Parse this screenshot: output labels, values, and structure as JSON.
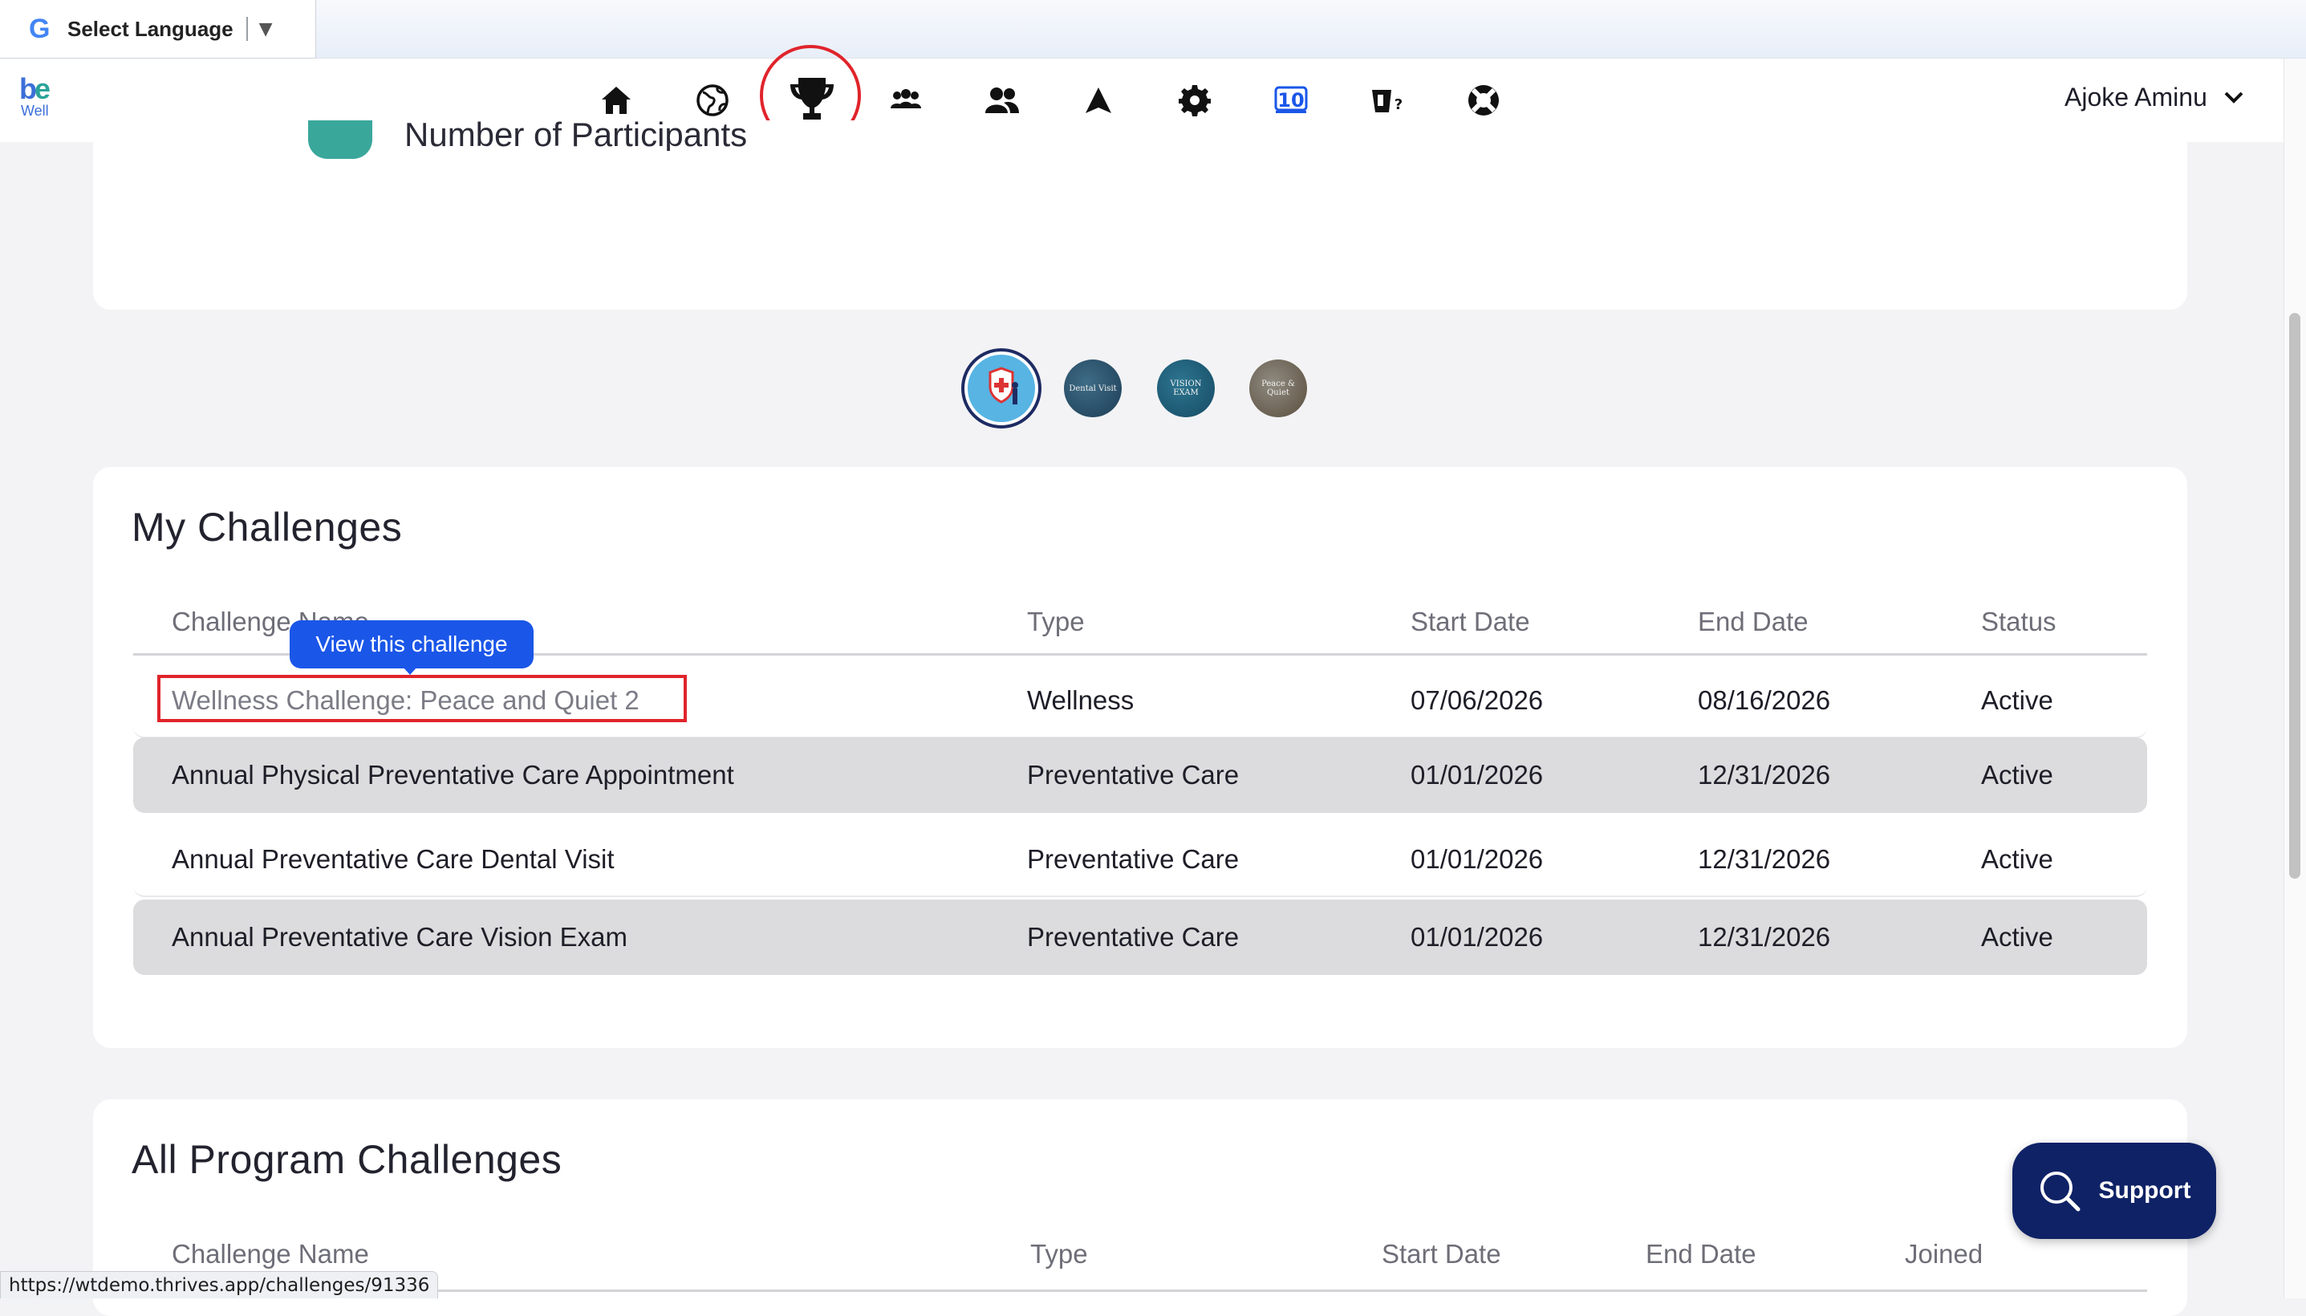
{
  "translate": {
    "label": "Select Language",
    "arrow": "▼"
  },
  "logo": {
    "be_b": "b",
    "be_e": "e",
    "well": "Well"
  },
  "nav": {
    "items": [
      {
        "name": "home-icon"
      },
      {
        "name": "globe-icon"
      },
      {
        "name": "trophy-icon"
      },
      {
        "name": "groups-icon"
      },
      {
        "name": "people-icon"
      },
      {
        "name": "navigation-arrow-icon"
      },
      {
        "name": "gear-icon"
      },
      {
        "name": "counter-10-icon"
      },
      {
        "name": "cup-question-icon"
      },
      {
        "name": "lifebuoy-icon"
      }
    ],
    "counter_value": "10",
    "user_name": "Ajoke Aminu"
  },
  "summary": {
    "participants_label": "Number of Participants"
  },
  "badges": [
    {
      "label": ""
    },
    {
      "label": "Dental Visit"
    },
    {
      "label": "VISION EXAM"
    },
    {
      "label": "Peace & Quiet"
    }
  ],
  "my_challenges": {
    "title": "My Challenges",
    "columns": [
      "Challenge Name",
      "Type",
      "Start Date",
      "End Date",
      "Status"
    ],
    "tooltip": "View this challenge",
    "rows": [
      [
        "Wellness Challenge: Peace and Quiet 2",
        "Wellness",
        "07/06/2026",
        "08/16/2026",
        "Active"
      ],
      [
        "Annual Physical Preventative Care Appointment",
        "Preventative Care",
        "01/01/2026",
        "12/31/2026",
        "Active"
      ],
      [
        "Annual Preventative Care Dental Visit",
        "Preventative Care",
        "01/01/2026",
        "12/31/2026",
        "Active"
      ],
      [
        "Annual Preventative Care Vision Exam",
        "Preventative Care",
        "01/01/2026",
        "12/31/2026",
        "Active"
      ]
    ]
  },
  "all_challenges": {
    "title": "All Program Challenges",
    "columns": [
      "Challenge Name",
      "Type",
      "Start Date",
      "End Date",
      "Joined"
    ]
  },
  "support": {
    "label": "Support"
  },
  "status_url": "https://wtdemo.thrives.app/challenges/91336",
  "colors": {
    "accent": "#1a56e8",
    "highlight": "#e0242b",
    "navy": "#0f2266",
    "teal": "#3aa79b"
  }
}
